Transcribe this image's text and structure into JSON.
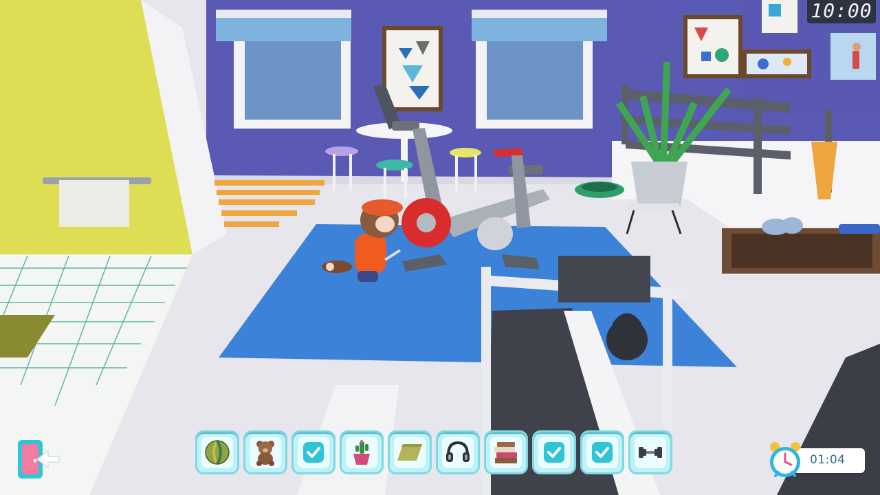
{
  "wall_clock": {
    "time": "10:00"
  },
  "exit_button": {
    "icon": "exit-door-icon"
  },
  "item_tray": {
    "slots": [
      {
        "icon": "beach-ball-icon",
        "state": "pending"
      },
      {
        "icon": "teddy-bear-icon",
        "state": "pending"
      },
      {
        "icon": "checkmark-icon",
        "state": "done"
      },
      {
        "icon": "potted-cactus-icon",
        "state": "pending"
      },
      {
        "icon": "yoga-mat-icon",
        "state": "pending"
      },
      {
        "icon": "headphones-icon",
        "state": "pending"
      },
      {
        "icon": "book-stack-icon",
        "state": "pending"
      },
      {
        "icon": "checkmark-icon",
        "state": "done"
      },
      {
        "icon": "checkmark-icon",
        "state": "done"
      },
      {
        "icon": "dumbbell-icon",
        "state": "pending"
      }
    ]
  },
  "timer": {
    "value": "01:04",
    "icon": "alarm-clock-icon"
  },
  "colors": {
    "accent": "#7ed8e2",
    "check": "#2fc4d6",
    "mat": "#3b82d8",
    "wall": "#5c5bb6"
  }
}
